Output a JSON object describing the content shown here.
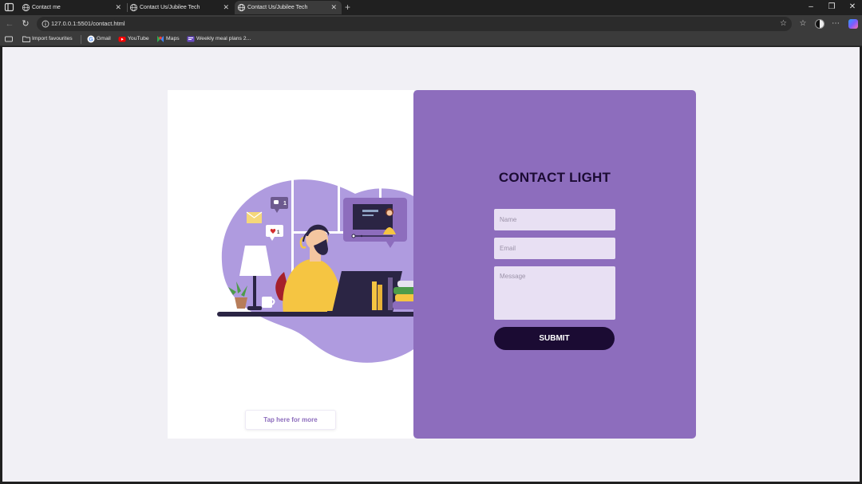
{
  "browser": {
    "tabs": [
      {
        "title": "Contact me",
        "active": false
      },
      {
        "title": "Contact Us/Jubilee Tech",
        "active": false
      },
      {
        "title": "Contact Us/Jubilee Tech",
        "active": true
      }
    ],
    "new_tab_symbol": "+",
    "address": {
      "url": "127.0.0.1:5501/contact.html"
    },
    "bookmarks": [
      {
        "label": "Import favourites",
        "icon": "folder-icon"
      },
      {
        "label": "Gmail",
        "icon": "google-icon"
      },
      {
        "label": "YouTube",
        "icon": "youtube-icon"
      },
      {
        "label": "Maps",
        "icon": "maps-icon"
      },
      {
        "label": "Weekly meal plans 2...",
        "icon": "meal-plan-icon"
      }
    ]
  },
  "page": {
    "form": {
      "title": "CONTACT LIGHT",
      "name_placeholder": "Name",
      "email_placeholder": "Email",
      "message_placeholder": "Message",
      "submit_label": "SUBMIT"
    },
    "tap_button_label": "Tap here for more",
    "illustration_bubble_count": "1",
    "illustration_heart_count": "1"
  },
  "colors": {
    "accent_purple": "#8d6dbd",
    "dark_navy": "#1b0b33",
    "field_bg": "#e8e0f3",
    "page_bg": "#f1f0f5"
  }
}
